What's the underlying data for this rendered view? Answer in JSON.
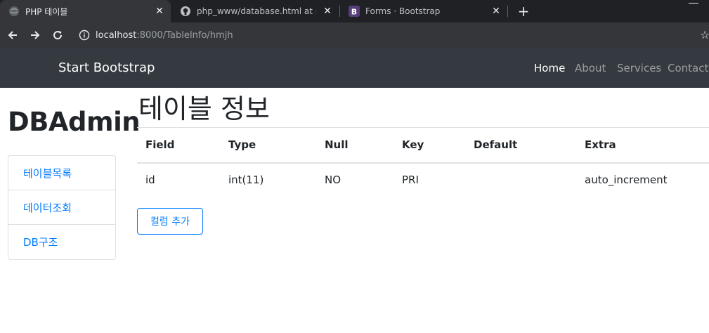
{
  "browser": {
    "tabs": [
      {
        "title": "PHP 테이블",
        "active": true
      },
      {
        "title": "php_www/database.html at mas",
        "active": false
      },
      {
        "title": "Forms · Bootstrap",
        "active": false
      }
    ],
    "url_host": "localhost",
    "url_rest": ":8000/TableInfo/hmjh"
  },
  "navbar": {
    "brand": "Start Bootstrap",
    "links": [
      "Home",
      "About",
      "Services",
      "Contact"
    ]
  },
  "sidebar": {
    "title": "DBAdmin",
    "items": [
      "테이블목록",
      "데이터조회",
      "DB구조"
    ]
  },
  "main": {
    "title": "테이블 정보",
    "table": {
      "headers": [
        "Field",
        "Type",
        "Null",
        "Key",
        "Default",
        "Extra"
      ],
      "rows": [
        [
          "id",
          "int(11)",
          "NO",
          "PRI",
          "",
          "auto_increment"
        ]
      ]
    },
    "add_column_label": "컬럼 추가"
  },
  "colors": {
    "primary": "#007bff",
    "navbar_bg": "#343a40",
    "chrome_dark": "#202124"
  }
}
